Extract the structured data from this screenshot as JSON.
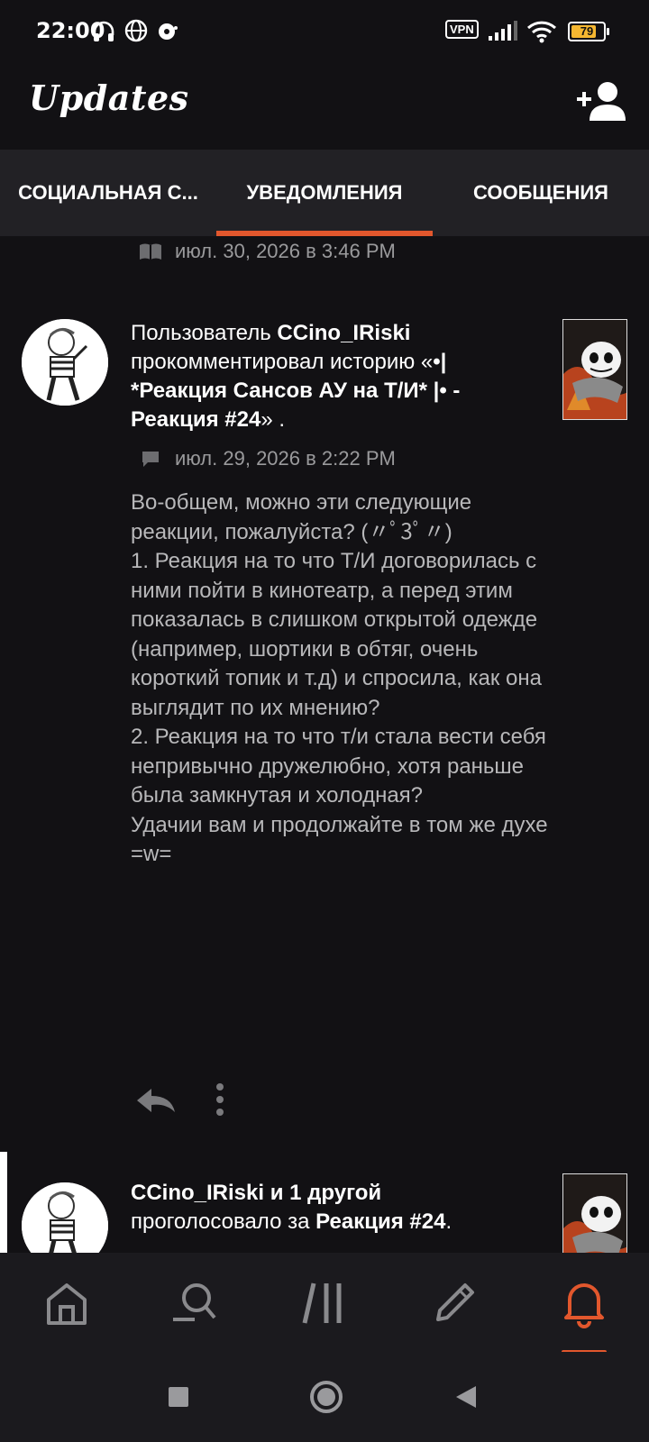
{
  "status_bar": {
    "time": "22:00",
    "vpn_label": "VPN",
    "battery_pct": "79",
    "battery_level": 0.79,
    "accent_battery": "#f5b731"
  },
  "header": {
    "title": "Updates",
    "add_user_icon": "add-user-icon"
  },
  "tabs": [
    {
      "label": "СОЦИАЛЬНАЯ С...",
      "active": false
    },
    {
      "label": "УВЕДОМЛЕНИЯ",
      "active": true
    },
    {
      "label": "СООБЩЕНИЯ",
      "active": false
    }
  ],
  "accent_color": "#e2572d",
  "prev_item": {
    "meta_icon": "book-icon",
    "timestamp": "июл. 30, 2026 в 3:46 PM"
  },
  "notification": {
    "prefix": "Пользователь ",
    "user": "CCino_IRiski",
    "action": " прокомментировал историю «",
    "story": "•| *Реакция Сансов АУ на Т/И* |• - Реакция #24",
    "suffix": "» .",
    "meta_icon": "comment-icon",
    "timestamp": "июл. 29, 2026 в 2:22 PM",
    "comment": "Во-общем, можно эти следующие реакции, пожалуйста? (〃ﾟ3ﾟ〃)\n1. Реакция на то что Т/И договорилась с ними пойти в кинотеатр, а перед этим показалась в слишком открытой одежде (например, шортики в обтяг, очень короткий топик и т.д) и спросила, как она выглядит по их мнению?\n2. Реакция на то что т/и стала вести себя непривычно дружелюбно, хотя раньше была замкнутая и холодная?\nУдачии вам и продолжайте в том же духе =w=",
    "reply_icon": "reply-icon",
    "more_icon": "more-vertical-icon"
  },
  "notification2": {
    "user": "CCino_IRiski и 1 другой",
    "action": "проголосовало за ",
    "target": "Реакция #24",
    "suffix": "."
  },
  "bottom_nav": [
    {
      "icon": "home-icon"
    },
    {
      "icon": "search-icon"
    },
    {
      "icon": "library-icon"
    },
    {
      "icon": "write-icon"
    },
    {
      "icon": "bell-icon",
      "active": true
    }
  ],
  "system_nav": [
    "recents-icon",
    "home-circle-icon",
    "back-icon"
  ]
}
